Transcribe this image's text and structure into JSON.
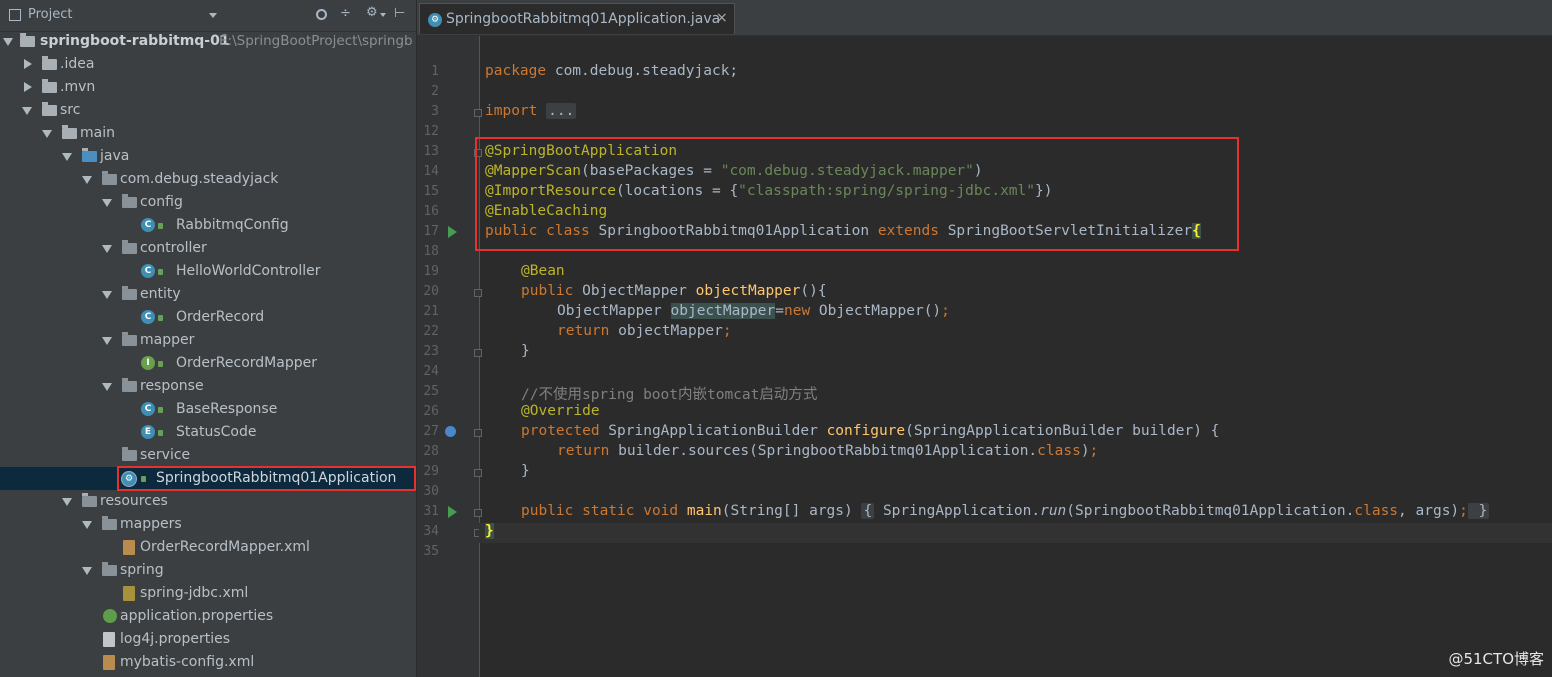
{
  "project_header": {
    "title": "Project",
    "icons": [
      "project-icon",
      "dropdown-icon",
      "target-icon",
      "collapse-icon",
      "gear-icon",
      "hide-icon"
    ]
  },
  "tree": {
    "root_name": "springboot-rabbitmq-01",
    "root_path": "E:\\SpringBootProject\\springb",
    "items": [
      {
        "label": ".idea"
      },
      {
        "label": ".mvn"
      },
      {
        "label": "src"
      },
      {
        "label": "main"
      },
      {
        "label": "java"
      },
      {
        "label": "com.debug.steadyjack"
      },
      {
        "label": "config"
      },
      {
        "label": "RabbitmqConfig"
      },
      {
        "label": "controller"
      },
      {
        "label": "HelloWorldController"
      },
      {
        "label": "entity"
      },
      {
        "label": "OrderRecord"
      },
      {
        "label": "mapper"
      },
      {
        "label": "OrderRecordMapper"
      },
      {
        "label": "response"
      },
      {
        "label": "BaseResponse"
      },
      {
        "label": "StatusCode"
      },
      {
        "label": "service"
      },
      {
        "label": "SpringbootRabbitmq01Application"
      },
      {
        "label": "resources"
      },
      {
        "label": "mappers"
      },
      {
        "label": "OrderRecordMapper.xml"
      },
      {
        "label": "spring"
      },
      {
        "label": "spring-jdbc.xml"
      },
      {
        "label": "application.properties"
      },
      {
        "label": "log4j.properties"
      },
      {
        "label": "mybatis-config.xml"
      }
    ]
  },
  "editor": {
    "tab_label": "SpringbootRabbitmq01Application.java",
    "tab_close": "×",
    "line_numbers": [
      "1",
      "2",
      "3",
      "12",
      "13",
      "14",
      "15",
      "16",
      "17",
      "18",
      "19",
      "20",
      "21",
      "22",
      "23",
      "24",
      "25",
      "26",
      "27",
      "28",
      "29",
      "30",
      "31",
      "34",
      "35"
    ],
    "code": {
      "l1_kw": "package",
      "l1_rest": " com.debug.steadyjack;",
      "l3_kw": "import",
      "l3_fold": "...",
      "l13": "@SpringBootApplication",
      "l14_an": "@MapperScan",
      "l14_a": "(basePackages = ",
      "l14_st": "\"com.debug.steadyjack.mapper\"",
      "l14_b": ")",
      "l15_an": "@ImportResource",
      "l15_a": "(locations = {",
      "l15_st": "\"classpath:spring/spring-jdbc.xml\"",
      "l15_b": "})",
      "l16": "@EnableCaching",
      "l17_kw1": "public class",
      "l17_name": " SpringbootRabbitmq01Application ",
      "l17_kw2": "extends",
      "l17_super": " SpringBootServletInitializer",
      "l17_brace": "{",
      "l19": "@Bean",
      "l20_kw": "public",
      "l20_type": " ObjectMapper ",
      "l20_fn": "objectMapper",
      "l20_rest": "(){",
      "l21_type": "ObjectMapper ",
      "l21_var": "objectMapper",
      "l21_eq": "=",
      "l21_kw": "new",
      "l21_rest": " ObjectMapper()",
      "l21_semi": ";",
      "l22_kw": "return",
      "l22_rest": " objectMapper",
      "l22_semi": ";",
      "l23": "}",
      "l25": "//不使用spring boot内嵌tomcat启动方式",
      "l26": "@Override",
      "l27_kw": "protected",
      "l27_type": " SpringApplicationBuilder ",
      "l27_fn": "configure",
      "l27_rest": "(SpringApplicationBuilder builder) {",
      "l28_kw": "return",
      "l28_rest": " builder.sources(SpringbootRabbitmq01Application.",
      "l28_kw2": "class",
      "l28_end": ")",
      "l28_semi": ";",
      "l29": "}",
      "l31_kw": "public static void",
      "l31_fn": " main",
      "l31_a": "(String[] args) ",
      "l31_brace1": "{",
      "l31_b": " SpringApplication.",
      "l31_it": "run",
      "l31_c": "(SpringbootRabbitmq01Application.",
      "l31_kw2": "class",
      "l31_d": ", args)",
      "l31_semi": ";",
      "l31_brace2": " }",
      "l34": "}"
    }
  },
  "watermark": "@51CTO博客",
  "colors": {
    "highlight_box": "#e4322f",
    "keyword": "#cc7832",
    "annotation": "#bbb529",
    "string": "#6a8759",
    "method": "#ffc66d",
    "comment": "#808080"
  }
}
